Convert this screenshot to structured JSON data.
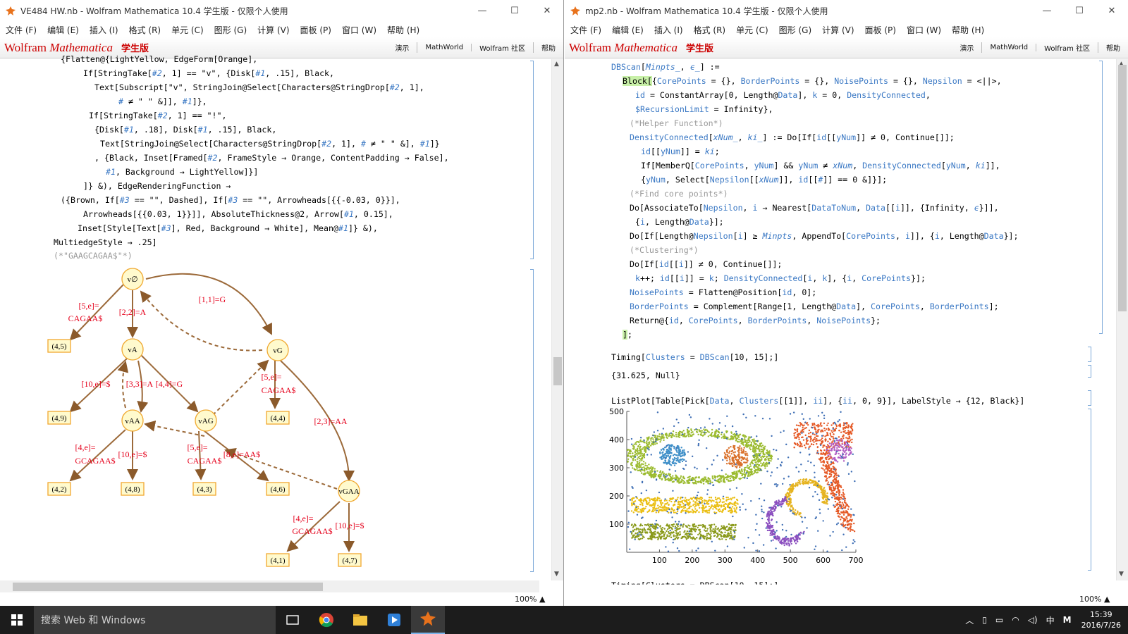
{
  "left": {
    "title": "VE484 HW.nb - Wolfram Mathematica 10.4 学生版 - 仅限个人使用",
    "menu": [
      "文件 (F)",
      "编辑 (E)",
      "插入 (I)",
      "格式 (R)",
      "单元 (C)",
      "图形 (G)",
      "计算 (V)",
      "面板 (P)",
      "窗口 (W)",
      "帮助 (H)"
    ],
    "brand": "Wolfram",
    "brand2": "Mathematica",
    "student": "学生版",
    "links": [
      "演示",
      "MathWorld",
      "Wolfram 社区",
      "帮助"
    ],
    "zoom": "100%",
    "code": {
      "l0": "{Flatten@{LightYellow, EdgeForm[Orange],",
      "l1a": "If[StringTake[",
      "l1b": "#2",
      "l1c": ", 1] == \"v\", {Disk[",
      "l1d": "#1",
      "l1e": ", .15], Black,",
      "l2a": "Text[Subscript[\"v\", StringJoin@Select[Characters@StringDrop[",
      "l2b": "#2",
      "l2c": ", 1],",
      "l3a": "#",
      "l3b": " ≠ \" \" &]], ",
      "l3c": "#1",
      "l3d": "]},",
      "l4a": "If[StringTake[",
      "l4b": "#2",
      "l4c": ", 1] == \"!\",",
      "l5a": "{Disk[",
      "l5b": "#1",
      "l5c": ", .18], Disk[",
      "l5d": "#1",
      "l5e": ", .15], Black,",
      "l6a": "Text[StringJoin@Select[Characters@StringDrop[",
      "l6b": "#2",
      "l6c": ", 1], ",
      "l6d": "#",
      "l6e": " ≠ \" \" &], ",
      "l6f": "#1",
      "l6g": "]}",
      "l7a": ", {Black, Inset[Framed[",
      "l7b": "#2",
      "l7c": ", FrameStyle → Orange, ContentPadding → False],",
      "l8a": "#1",
      "l8b": ", Background → LightYellow]}]",
      "l9": "]} &), EdgeRenderingFunction →",
      "l10a": "({Brown, If[",
      "l10b": "#3",
      "l10c": " == \"\", Dashed], If[",
      "l10d": "#3",
      "l10e": " == \"\", Arrowheads[{{-0.03, 0}}],",
      "l11a": "Arrowheads[{{0.03, 1}}]], AbsoluteThickness@2, Arrow[",
      "l11b": "#1",
      "l11c": ", 0.15],",
      "l12a": "Inset[Style[Text[",
      "l12b": "#3",
      "l12c": "], Red, Background → White], Mean@",
      "l12d": "#1",
      "l12e": "]} &),",
      "l13": "MultiedgeStyle → .25]",
      "l14": "(*\"GAAGCAGAA$\"*)"
    },
    "graph": {
      "nodes": {
        "v0": "v∅",
        "vA": "vA",
        "vG": "vG",
        "vAA": "vAA",
        "vAG": "vAG",
        "vGAA": "vGAA"
      },
      "leaves": [
        "(4,5)",
        "(4,9)",
        "(4,4)",
        "(4,2)",
        "(4,8)",
        "(4,3)",
        "(4,6)",
        "(4,1)",
        "(4,7)"
      ],
      "edges": [
        "[5,e]=",
        "CAGAA$",
        "[2,2]=A",
        "[1,1]=G",
        "[10,e]=$",
        "[3,3]=A",
        "[4,4]=G",
        "[5,e]=",
        "CAGAA$",
        "[2,3]=AA",
        "[4,e]=",
        "GCAGAA$",
        "[10,e]=$",
        "[5,e]=",
        "CAGAA$",
        "[8,e]=AA$",
        "[4,e]=",
        "GCAGAA$",
        "[10,e]=$"
      ]
    }
  },
  "right": {
    "title": "mp2.nb - Wolfram Mathematica 10.4 学生版 - 仅限个人使用",
    "menu": [
      "文件 (F)",
      "编辑 (E)",
      "插入 (I)",
      "格式 (R)",
      "单元 (C)",
      "图形 (G)",
      "计算 (V)",
      "面板 (P)",
      "窗口 (W)",
      "帮助 (H)"
    ],
    "brand": "Wolfram",
    "brand2": "Mathematica",
    "student": "学生版",
    "links": [
      "演示",
      "MathWorld",
      "Wolfram 社区",
      "帮助"
    ],
    "zoom": "100%",
    "output1": "{31.625, Null}",
    "chart_data": {
      "type": "scatter",
      "xlim": [
        0,
        700
      ],
      "ylim": [
        0,
        500
      ],
      "xticks": [
        "100",
        "200",
        "300",
        "400",
        "500",
        "600",
        "700"
      ],
      "yticks": [
        "100",
        "200",
        "300",
        "400",
        "500"
      ],
      "series": [
        {
          "color": "#9bbb2f"
        },
        {
          "color": "#3f8fc8"
        },
        {
          "color": "#d9702a"
        },
        {
          "color": "#e55a27"
        },
        {
          "color": "#b35ec4"
        },
        {
          "color": "#e5b31f"
        },
        {
          "color": "#8b4fbf"
        },
        {
          "color": "#eabe12"
        },
        {
          "color": "#8a9a1a"
        },
        {
          "color": "#3f6fb5"
        }
      ]
    }
  },
  "taskbar": {
    "search": "搜索 Web 和 Windows",
    "time": "15:39",
    "date": "2016/7/26",
    "ime": "中",
    "imeM": "M"
  }
}
